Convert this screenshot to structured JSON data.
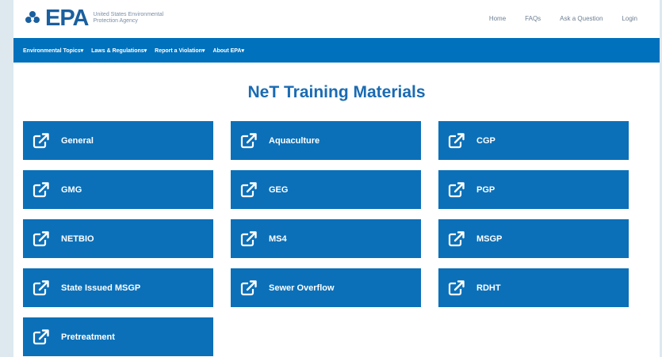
{
  "header": {
    "logo_text": "EPA",
    "agency_name": "United States Environmental Protection Agency",
    "utility_links": [
      "Home",
      "FAQs",
      "Ask a Question",
      "Login"
    ]
  },
  "nav": {
    "items": [
      "Environmental Topics▾",
      "Laws & Regulations▾",
      "Report a Violation▾",
      "About EPA▾"
    ]
  },
  "page": {
    "title": "NeT Training Materials"
  },
  "tiles": [
    {
      "label": "General"
    },
    {
      "label": "Aquaculture"
    },
    {
      "label": "CGP"
    },
    {
      "label": "GMG"
    },
    {
      "label": "GEG"
    },
    {
      "label": "PGP"
    },
    {
      "label": "NETBIO"
    },
    {
      "label": "MS4"
    },
    {
      "label": "MSGP"
    },
    {
      "label": "State Issued MSGP"
    },
    {
      "label": "Sewer Overflow"
    },
    {
      "label": "RDHT"
    },
    {
      "label": "Pretreatment"
    }
  ],
  "icons": {
    "tile_icon": "external-link-icon",
    "logo_icon": "epa-flower-icon"
  },
  "colors": {
    "brand_blue": "#0071bc",
    "tile_blue": "#0b70b8",
    "title_blue": "#1a6bb3"
  }
}
